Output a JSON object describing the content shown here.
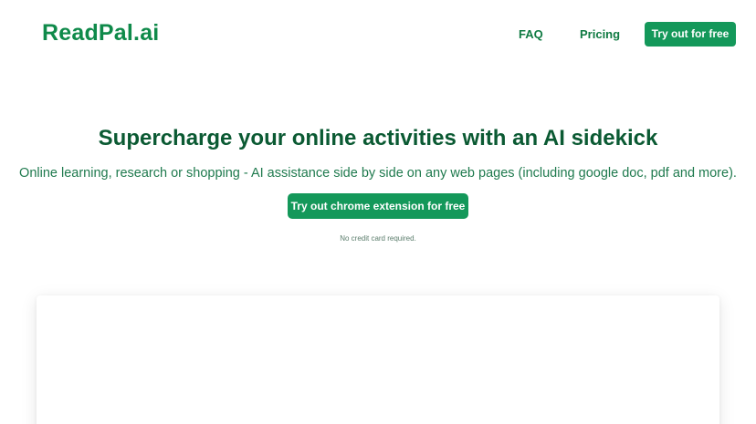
{
  "header": {
    "logo": "ReadPal.ai",
    "nav": {
      "faq": "FAQ",
      "pricing": "Pricing",
      "cta": "Try out for free"
    }
  },
  "hero": {
    "title": "Supercharge your online activities with an AI sidekick",
    "subtitle": "Online learning, research or shopping - AI assistance side by side on any web pages (including google doc, pdf and more).",
    "cta": "Try out chrome extension for free",
    "note": "No credit card required."
  },
  "colors": {
    "brand": "#0f8a4a",
    "button": "#14985a",
    "heading": "#0b5a33"
  }
}
